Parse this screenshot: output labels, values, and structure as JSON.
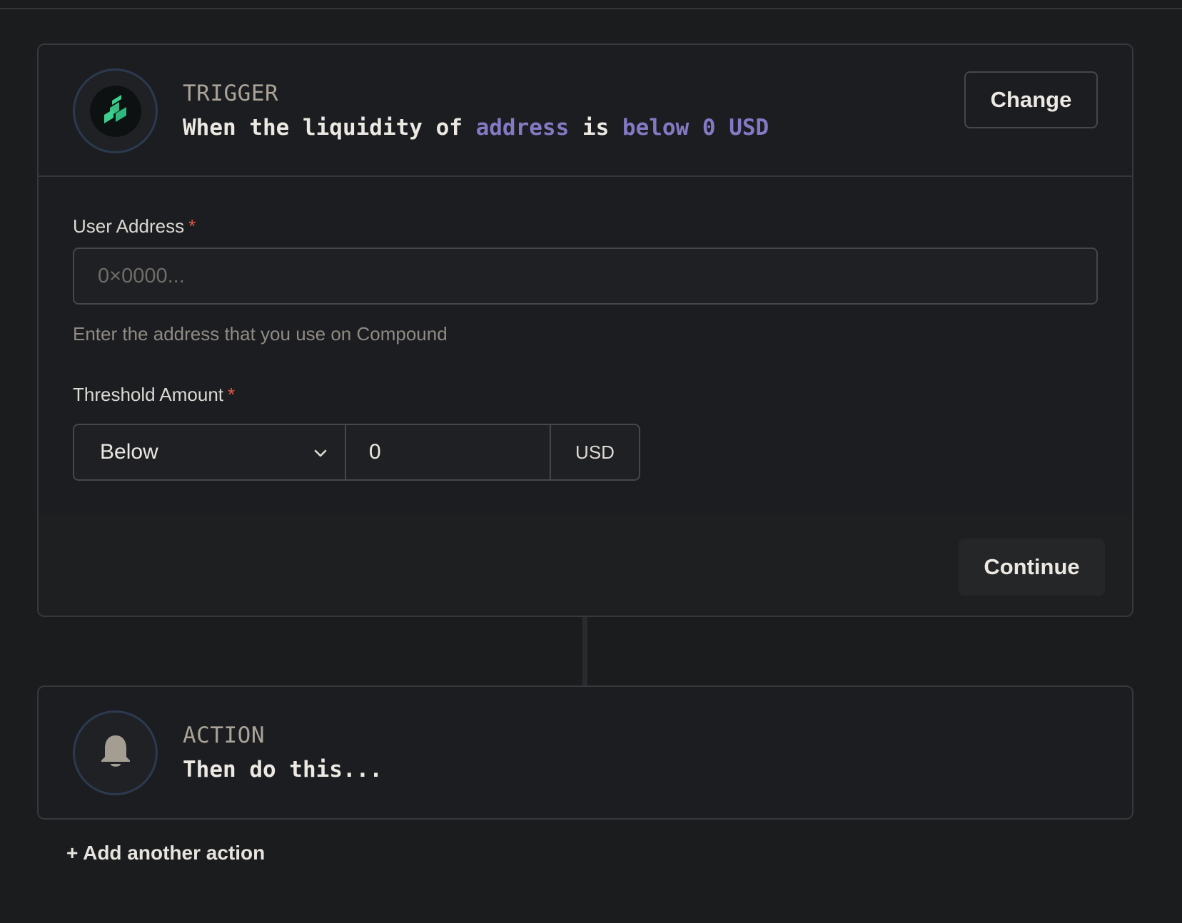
{
  "trigger": {
    "tag": "TRIGGER",
    "sentence": {
      "part1": "When the liquidity of ",
      "address": "address",
      "part2": " is ",
      "condition": "below 0 USD"
    },
    "change_label": "Change",
    "icon": "compound-logo-icon",
    "accent_color": "#8479c4"
  },
  "form": {
    "user_address": {
      "label": "User Address",
      "required_mark": "*",
      "placeholder": "0×0000...",
      "value": "",
      "help": "Enter the address that you use on Compound"
    },
    "threshold": {
      "label": "Threshold Amount",
      "required_mark": "*",
      "direction": "Below",
      "amount": "0",
      "unit": "USD"
    }
  },
  "continue_label": "Continue",
  "action": {
    "tag": "ACTION",
    "sentence": "Then do this...",
    "icon": "bell-icon"
  },
  "add_action_label": "+ Add another action"
}
